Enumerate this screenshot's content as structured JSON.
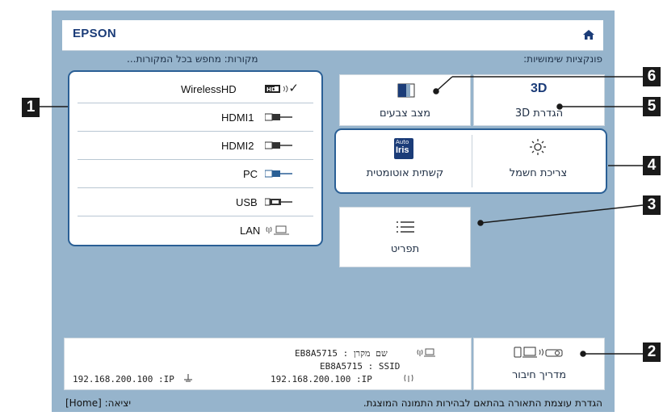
{
  "header": {
    "brand": "EPSON",
    "home_icon": "home-icon"
  },
  "labels": {
    "functions": "פונקציות שימושיות:",
    "sources": "מקורות: מחפש בכל המקורות..."
  },
  "sources": [
    {
      "label": "WirelessHD",
      "icon": "wirelesshd-icon",
      "selected": true
    },
    {
      "label": "HDMI1",
      "icon": "hdmi-icon",
      "selected": false
    },
    {
      "label": "HDMI2",
      "icon": "hdmi-icon",
      "selected": false
    },
    {
      "label": "PC",
      "icon": "vga-icon",
      "selected": false
    },
    {
      "label": "USB",
      "icon": "usb-icon",
      "selected": false
    },
    {
      "label": "LAN",
      "icon": "lan-icon",
      "selected": false
    }
  ],
  "functions": {
    "color_mode": "מצב צבעים",
    "setting_3d": "הגדרת 3D",
    "auto_iris": "קשתית אוטומטית",
    "auto_iris_badge_top": "Auto",
    "auto_iris_badge_bottom": "Iris",
    "power_consumption": "צריכת חשמל",
    "menu": "תפריט",
    "connection_guide": "מדריך חיבור",
    "badge_3d": "3D"
  },
  "network": {
    "source_name": "EB8A5715 : שם מקרן",
    "ssid": "EB8A5715 : SSID",
    "ip_wireless": "192.168.200.100 :IP",
    "ip_wired": "192.168.200.100 :IP"
  },
  "footer": {
    "hint": "הגדרת עוצמת התאורה בהתאם לבהירות התמונה המוצגת.",
    "exit": "[Home] :יציאה"
  },
  "callouts": [
    "1",
    "2",
    "3",
    "4",
    "5",
    "6"
  ],
  "colors": {
    "background": "#96b4cc",
    "accent": "#2a5f95",
    "brand": "#1b3c78"
  }
}
